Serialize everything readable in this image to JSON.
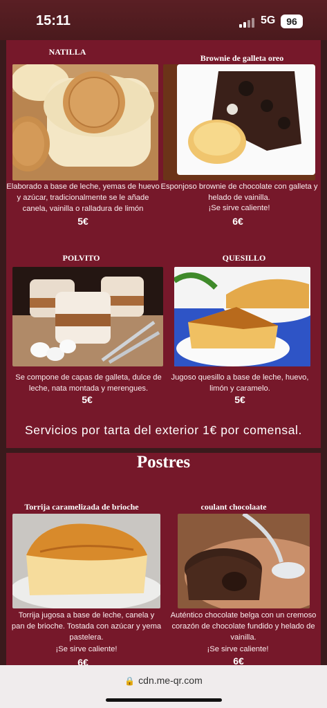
{
  "status_bar": {
    "time": "15:11",
    "network": "5G",
    "battery": "96"
  },
  "items": [
    {
      "title": "NATILLA",
      "desc": "Elaborado a base de leche, yemas de huevo y azúcar, tradicionalmente se le añade canela, vainilla o ralladura de limón",
      "price": "5€"
    },
    {
      "title": "Brownie de galleta oreo",
      "desc": "Esponjoso brownie de chocolate con galleta y helado de vainilla.",
      "note": "¡Se sirve caliente!",
      "price": "6€"
    },
    {
      "title": "POLVITO",
      "desc": "Se compone de capas de galleta, dulce de leche, nata montada y merengues.",
      "price": "5€"
    },
    {
      "title": "QUESILLO",
      "desc": "Jugoso quesillo a base de leche, huevo, limón y caramelo.",
      "price": "5€"
    },
    {
      "title": "Torrija caramelizada de brioche",
      "desc": "Torrija jugosa a base de leche, canela y pan de brioche. Tostada con azúcar y yema pastelera.",
      "note": "¡Se sirve caliente!",
      "price": "6€"
    },
    {
      "title": "coulant chocolaate",
      "desc": "Auténtico chocolate belga con un cremoso corazón de chocolate fundido y helado de vainilla.",
      "note": "¡Se sirve caliente!",
      "price": "6€"
    }
  ],
  "services_text": "Servicios por tarta del exterior 1€ por comensal.",
  "section_title": "Postres",
  "url": "cdn.me-qr.com",
  "colors": {
    "panel": "#76182a",
    "background": "#3a1a1c"
  }
}
